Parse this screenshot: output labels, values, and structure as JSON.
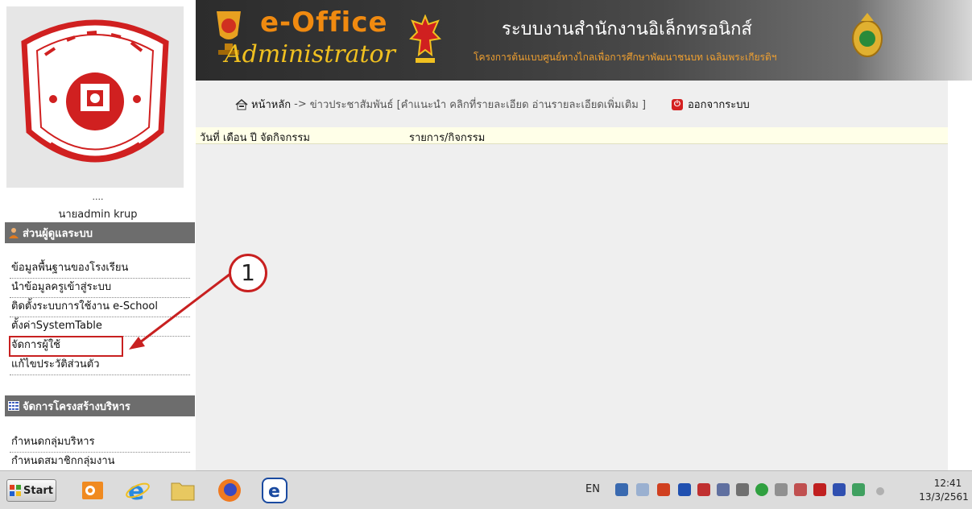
{
  "sidebar": {
    "user_dots": "....",
    "user_name": "นายadmin krup",
    "admin_section": {
      "title": "ส่วนผู้ดูแลระบบ",
      "items": [
        "ข้อมูลพื้นฐานของโรงเรียน",
        "นำข้อมูลครูเข้าสู่ระบบ",
        "ติดตั้งระบบการใช้งาน e-School",
        "ตั้งค่าSystemTable",
        "จัดการผู้ใช้",
        "แก้ไขประวัติส่วนตัว"
      ]
    },
    "org_section": {
      "title": "จัดการโครงสร้างบริหาร",
      "items": [
        "กำหนดกลุ่มบริหาร",
        "กำหนดสมาชิกกลุ่มงาน"
      ]
    }
  },
  "banner": {
    "brand_main": "e-Office",
    "brand_sub": "Administrator",
    "title": "ระบบงานสำนักงานอิเล็กทรอนิกส์",
    "subtitle": "โครงการต้นแบบศูนย์ทางไกลเพื่อการศึกษาพัฒนาชนบท เฉลิมพระเกียรติฯ"
  },
  "breadcrumb": {
    "home": "หน้าหลัก",
    "separator": "->",
    "current": "ข่าวประชาสัมพันธ์ [คำแนะนำ คลิกที่รายละเอียด อ่านรายละเอียดเพิ่มเติม ]"
  },
  "logout_label": "ออกจากระบบ",
  "table": {
    "columns": [
      "วันที่ เดือน ปี จัดกิจกรรม",
      "รายการ/กิจกรรม"
    ]
  },
  "annotation": {
    "number": "1"
  },
  "taskbar": {
    "start_label": "Start",
    "language": "EN",
    "time": "12:41",
    "date": "13/3/2561"
  },
  "colors": {
    "accent_red": "#c82020",
    "brand_orange": "#f08a10",
    "section_header_bg": "#6d6d6d"
  }
}
